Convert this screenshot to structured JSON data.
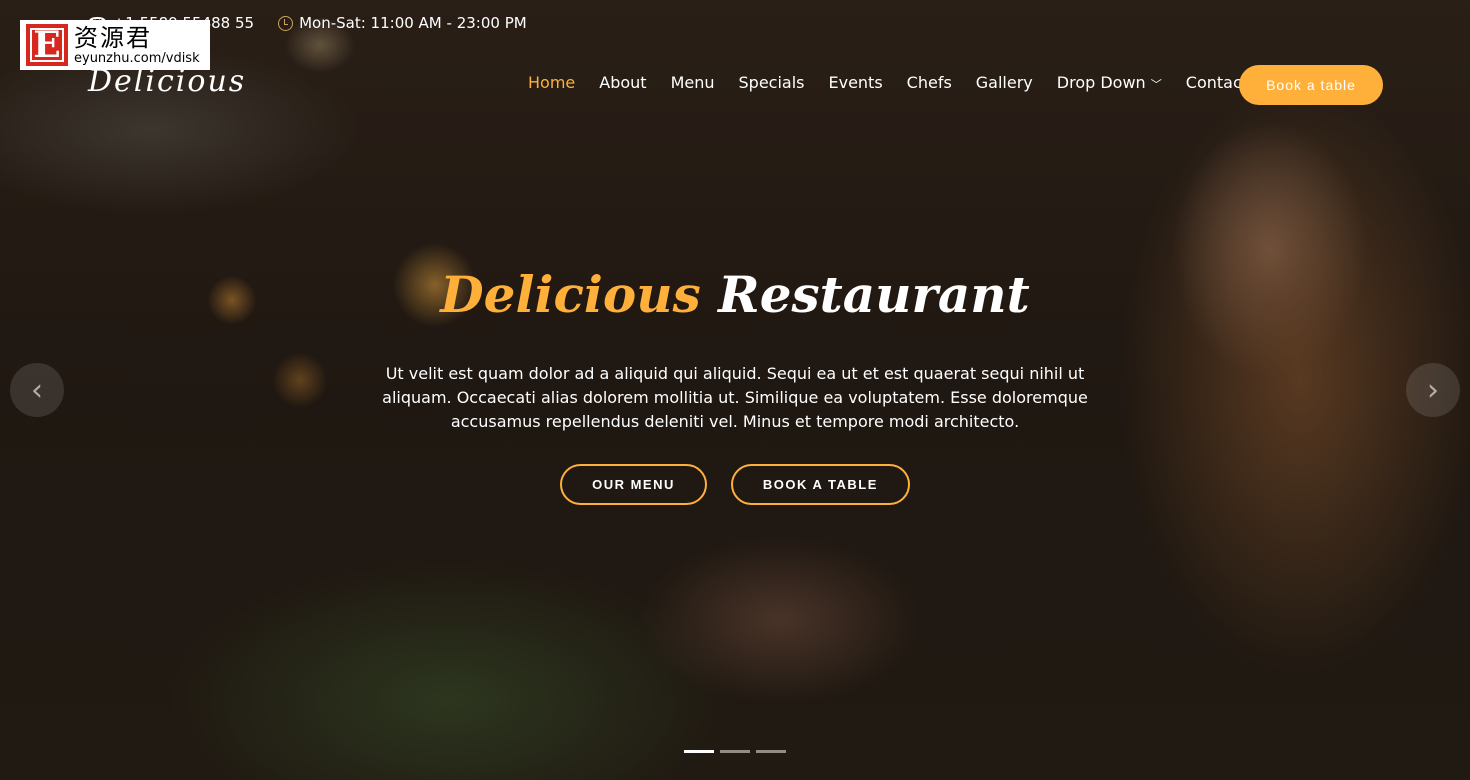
{
  "topbar": {
    "phone": "+1 5589 55488 55",
    "hours": "Mon-Sat: 11:00 AM - 23:00 PM"
  },
  "watermark": {
    "title": "资源君",
    "url": "eyunzhu.com/vdisk",
    "letter": "E"
  },
  "logo": "Delicious",
  "nav": [
    {
      "label": "Home",
      "active": true
    },
    {
      "label": "About"
    },
    {
      "label": "Menu"
    },
    {
      "label": "Specials"
    },
    {
      "label": "Events"
    },
    {
      "label": "Chefs"
    },
    {
      "label": "Gallery"
    },
    {
      "label": "Drop Down"
    },
    {
      "label": "Contact"
    }
  ],
  "book_button": "Book a table",
  "hero": {
    "title_accent": "Delicious",
    "title_rest": "Restaurant",
    "description": "Ut velit est quam dolor ad a aliquid qui aliquid. Sequi ea ut et est quaerat sequi nihil ut aliquam. Occaecati alias dolorem mollitia ut. Similique ea voluptatem. Esse doloremque accusamus repellendus deleniti vel. Minus et tempore modi architecto.",
    "btn_menu": "OUR MENU",
    "btn_book": "BOOK A TABLE"
  },
  "carousel": {
    "slides": 3,
    "active": 1
  },
  "colors": {
    "accent": "#ffb03b"
  }
}
